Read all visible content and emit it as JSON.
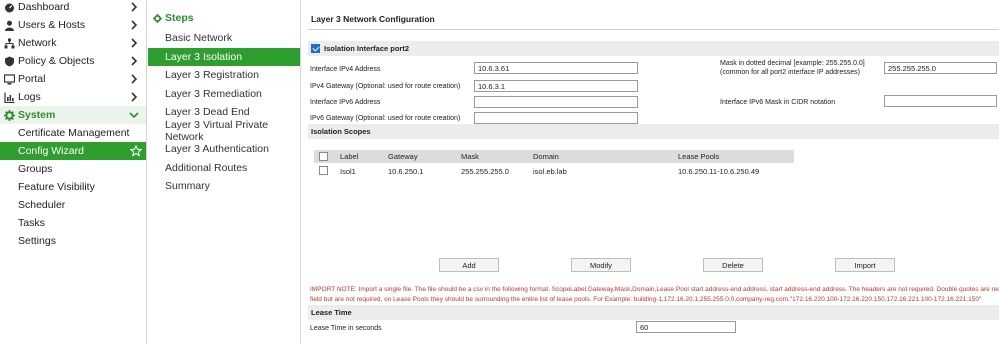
{
  "nav": {
    "items": [
      {
        "label": "Dashboard",
        "icon": "dashboard-icon"
      },
      {
        "label": "Users & Hosts",
        "icon": "users-icon"
      },
      {
        "label": "Network",
        "icon": "network-icon"
      },
      {
        "label": "Policy & Objects",
        "icon": "policy-icon"
      },
      {
        "label": "Portal",
        "icon": "portal-icon"
      },
      {
        "label": "Logs",
        "icon": "logs-icon"
      },
      {
        "label": "System",
        "icon": "gear-icon"
      }
    ],
    "system_children": [
      "Certificate Management",
      "Config Wizard",
      "Groups",
      "Feature Visibility",
      "Scheduler",
      "Tasks",
      "Settings"
    ],
    "active_child": "Config Wizard"
  },
  "steps": {
    "header": "Steps",
    "items": [
      "Basic Network",
      "Layer 3 Isolation",
      "Layer 3 Registration",
      "Layer 3 Remediation",
      "Layer 3 Dead End",
      "Layer 3 Virtual Private Network",
      "Layer 3 Authentication",
      "Additional Routes",
      "Summary"
    ],
    "active": "Layer 3 Isolation"
  },
  "main": {
    "title": "Layer 3 Network Configuration",
    "isolation_interface": {
      "label": "Isolation Interface port2",
      "checked": true
    },
    "fields": {
      "ipv4_address_label": "Interface IPv4 Address",
      "ipv4_address_value": "10.6.3.61",
      "ipv4_gateway_label": "IPv4 Gateway (Optional: used for route creation)",
      "ipv4_gateway_value": "10.6.3.1",
      "ipv6_address_label": "Interface IPv6 Address",
      "ipv6_address_value": "",
      "ipv6_gateway_label": "IPv6 Gateway (Optional: used for route creation)",
      "ipv6_gateway_value": "",
      "mask_label_line1": "Mask in dotted decimal [example: 255.255.0.0]",
      "mask_label_line2": "(common for all port2 interface IP addresses)",
      "mask_value": "255.255.255.0",
      "ipv6_mask_label": "Interface IPv6 Mask in CIDR notation",
      "ipv6_mask_value": ""
    },
    "isolation_scopes": {
      "header": "Isolation Scopes",
      "columns": [
        "Label",
        "Gateway",
        "Mask",
        "Domain",
        "Lease Pools"
      ],
      "rows": [
        {
          "label": "Isol1",
          "gateway": "10.6.250.1",
          "mask": "255.255.255.0",
          "domain": "isol.eb.lab",
          "lease_pools": "10.6.250.11-10.6.250.49"
        }
      ]
    },
    "buttons": {
      "add": "Add",
      "modify": "Modify",
      "delete": "Delete",
      "import": "Import"
    },
    "import_note_line1": "IMPORT NOTE: Import a single file. The file should be a csv in the following format. ScopeLabel,Gateway,Mask,Domain,Lease Pool start address-end address, start address-end address. The headers are not required. Double quotes are required",
    "import_note_line2": "field but are not required, on Lease Pools they should be surrounding the entire list of lease pools. For Example: building-1,172.16.20.1,255.255.0.0,company-reg.com,\"172.16.220.100-172.16.220.150,172.16.221.100-172.16.221.150\"",
    "lease_time": {
      "header": "Lease Time",
      "label": "Lease Time in seconds",
      "value": "60"
    }
  },
  "colors": {
    "accent_green": "#2e9e2e",
    "header_green": "#2c8f2c",
    "note_red": "#c0392b",
    "section_gray": "#ececec"
  }
}
